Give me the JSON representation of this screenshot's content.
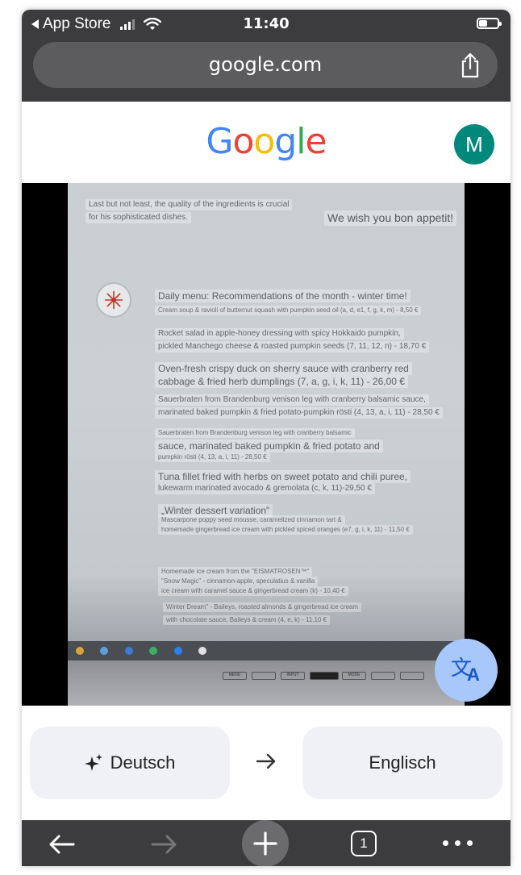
{
  "status_bar": {
    "back_label": "App Store",
    "time": "11:40",
    "battery_level": 0.45
  },
  "url_bar": {
    "url": "google.com"
  },
  "header": {
    "logo_letters": [
      {
        "char": "G",
        "color": "#4285F4"
      },
      {
        "char": "o",
        "color": "#EA4335"
      },
      {
        "char": "o",
        "color": "#FBBC05"
      },
      {
        "char": "g",
        "color": "#4285F4"
      },
      {
        "char": "l",
        "color": "#34A853"
      },
      {
        "char": "e",
        "color": "#EA4335"
      }
    ],
    "avatar_initial": "M"
  },
  "camera_overlays": {
    "intro_1": "Last but not least, the quality of the ingredients is crucial",
    "intro_2": "for his sophisticated dishes.",
    "bon_appetit": "We wish you bon appetit!",
    "menu_title": "Daily menu: Recommendations of the month - winter time!",
    "item1": "Cream soup & ravioli of butternut squash with pumpkin seed oil (a, d, e1, f, g, k, m) - 8,50 €",
    "item2a": "Rocket salad in apple-honey dressing with spicy Hokkaido pumpkin,",
    "item2b": "pickled Manchego cheese & roasted pumpkin seeds (7, 11, 12, n) - 18,70 €",
    "item3a": "Oven-fresh crispy duck on sherry sauce with cranberry red",
    "item3b": "cabbage & fried herb dumplings (7, a, g, i, k, 11) - 26,00 €",
    "item4a": "Sauerbraten from Brandenburg venison leg with cranberry balsamic sauce,",
    "item4b": "marinated baked pumpkin & fried potato-pumpkin rösti (4, 13, a, i, 11) - 28,50 €",
    "item5a": "Sauerbraten from Brandenburg venison leg with cranberry balsamic",
    "item5b": "sauce, marinated baked pumpkin & fried potato and",
    "item5c": "pumpkin rösti (4, 13, a, i, 11) - 28,50 €",
    "item6a": "Tuna fillet fried with herbs on sweet potato and chili puree,",
    "item6b": "lukewarm marinated avocado & gremolata (c, k, 11)-29,50 €",
    "dessert_title": "„Winter dessert variation\"",
    "dessert_a": "Mascarpone poppy seed mousse, caramelized cinnamon tart &",
    "dessert_b": "homemade gingerbread ice cream with pickled spiced oranges (e7, g, i, k, 11) - 11,50 €",
    "ice_a": "Homemade ice cream from the \"EISMATROSEN™\"",
    "ice_b": "\"Snow Magic\" - cinnamon-apple, speculatius & vanilla",
    "ice_c": "ice cream with caramel sauce & gingerbread cream (k) - 10,40 €",
    "dream_a": "Winter Dream\" - Baileys, roasted almonds & gingerbread ice cream",
    "dream_b": "with chocolate sauce, Baileys & cream (4, e, k) - 11,10 €",
    "bezel_menu": "MENU",
    "bezel_input": "INPUT",
    "bezel_mode": "MODE"
  },
  "translate_fab": {
    "glyph_a": "文",
    "glyph_b": "A"
  },
  "language_bar": {
    "source_language": "Deutsch",
    "target_language": "Englisch"
  },
  "toolbar": {
    "tab_count": "1"
  },
  "colors": {
    "chrome_dark": "#3c3c3e",
    "avatar": "#00897b",
    "fab": "#a8c7fa",
    "lang_button": "#f0f1f4"
  }
}
